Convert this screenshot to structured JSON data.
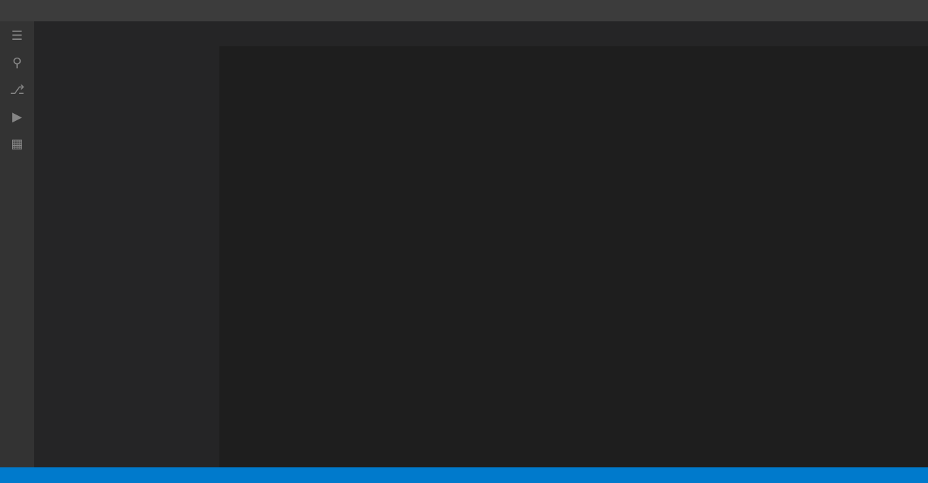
{
  "titlebar": {
    "title": ""
  },
  "activitybar": {
    "icons": [
      "explorer-icon",
      "search-icon",
      "source-control-icon",
      "run-icon",
      "extensions-icon"
    ]
  },
  "sidebar": {
    "header": "",
    "items": []
  },
  "tabs": [],
  "code": {
    "lines": []
  },
  "statusbar": {
    "items": []
  }
}
